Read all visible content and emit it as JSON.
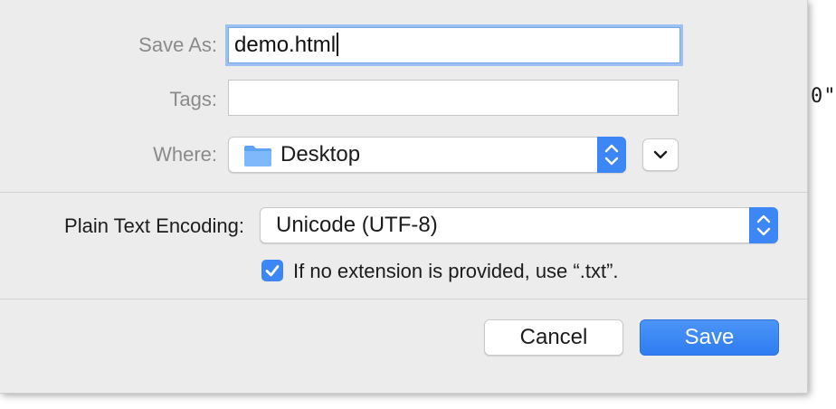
{
  "background": {
    "peek_text": "0\""
  },
  "dialog": {
    "save_as_label": "Save As:",
    "save_as_value": "demo.html",
    "tags_label": "Tags:",
    "tags_value": "",
    "where_label": "Where:",
    "where_value": "Desktop",
    "encoding_label": "Plain Text Encoding:",
    "encoding_value": "Unicode (UTF-8)",
    "extension_checkbox_label": "If no extension is provided, use “.txt”.",
    "extension_checkbox_checked": true,
    "cancel_label": "Cancel",
    "save_label": "Save"
  },
  "icons": {
    "where_folder": "folder-icon",
    "where_stepper": "up-down-chevron-icon",
    "expand": "chevron-down-icon",
    "encoding_stepper": "up-down-chevron-icon",
    "checkbox": "checkmark-icon"
  },
  "colors": {
    "accent": "#3d86f5",
    "focus_ring": "#9cc0f2",
    "sheet_background": "#ececec"
  }
}
